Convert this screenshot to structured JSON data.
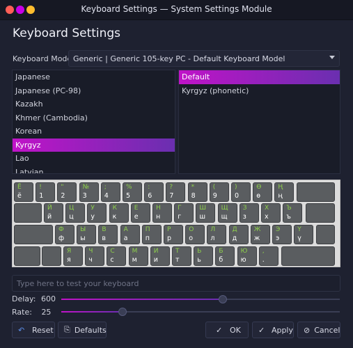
{
  "window": {
    "title": "Keyboard Settings — System Settings Module"
  },
  "heading": "Keyboard Settings",
  "model": {
    "label": "Keyboard Model:",
    "value": "Generic | Generic 105-key PC - Default Keyboard Model"
  },
  "layouts": [
    "Japanese",
    "Japanese (PC-98)",
    "Kazakh",
    "Khmer (Cambodia)",
    "Korean",
    "Kyrgyz",
    "Lao",
    "Latvian"
  ],
  "selected_layout": "Kyrgyz",
  "variants": [
    "Default",
    "Kyrgyz (phonetic)"
  ],
  "selected_variant": "Default",
  "keyboard": {
    "row1": [
      [
        "Ё",
        "ё"
      ],
      [
        "!",
        "1"
      ],
      [
        "\"",
        "2"
      ],
      [
        "№",
        "3"
      ],
      [
        ";",
        "4"
      ],
      [
        "%",
        "5"
      ],
      [
        ":",
        "6"
      ],
      [
        "?",
        "7"
      ],
      [
        "*",
        "8"
      ],
      [
        "(",
        "9"
      ],
      [
        ")",
        "0"
      ],
      [
        "Ө",
        "ө"
      ],
      [
        "Ң",
        "ң"
      ]
    ],
    "row2": [
      [
        "Й",
        "й"
      ],
      [
        "Ц",
        "ц"
      ],
      [
        "У",
        "у"
      ],
      [
        "К",
        "к"
      ],
      [
        "Е",
        "е"
      ],
      [
        "Н",
        "н"
      ],
      [
        "Г",
        "г"
      ],
      [
        "Ш",
        "ш"
      ],
      [
        "Щ",
        "щ"
      ],
      [
        "З",
        "з"
      ],
      [
        "Х",
        "х"
      ],
      [
        "Ъ",
        "ъ"
      ]
    ],
    "row3": [
      [
        "Ф",
        "ф"
      ],
      [
        "Ы",
        "ы"
      ],
      [
        "В",
        "в"
      ],
      [
        "А",
        "а"
      ],
      [
        "П",
        "п"
      ],
      [
        "Р",
        "р"
      ],
      [
        "О",
        "о"
      ],
      [
        "Л",
        "л"
      ],
      [
        "Д",
        "д"
      ],
      [
        "Ж",
        "ж"
      ],
      [
        "Э",
        "э"
      ],
      [
        "Ү",
        "ү"
      ]
    ],
    "row4": [
      [
        "Я",
        "я"
      ],
      [
        "Ч",
        "ч"
      ],
      [
        "С",
        "с"
      ],
      [
        "М",
        "м"
      ],
      [
        "И",
        "и"
      ],
      [
        "Т",
        "т"
      ],
      [
        "Ь",
        "ь"
      ],
      [
        "Б",
        "б"
      ],
      [
        "Ю",
        "ю"
      ],
      [
        ",",
        "."
      ]
    ]
  },
  "test_placeholder": "Type here to test your keyboard",
  "delay": {
    "label": "Delay:",
    "value": "600",
    "fraction": 0.58
  },
  "rate": {
    "label": "Rate:",
    "value": "25",
    "fraction": 0.22
  },
  "buttons": {
    "reset": "Reset",
    "defaults": "Defaults",
    "ok": "OK",
    "apply": "Apply",
    "cancel": "Cancel"
  },
  "icons": {
    "reset": "undo-icon",
    "defaults": "document-icon",
    "ok": "check-icon",
    "apply": "check-icon",
    "cancel": "cancel-icon"
  }
}
